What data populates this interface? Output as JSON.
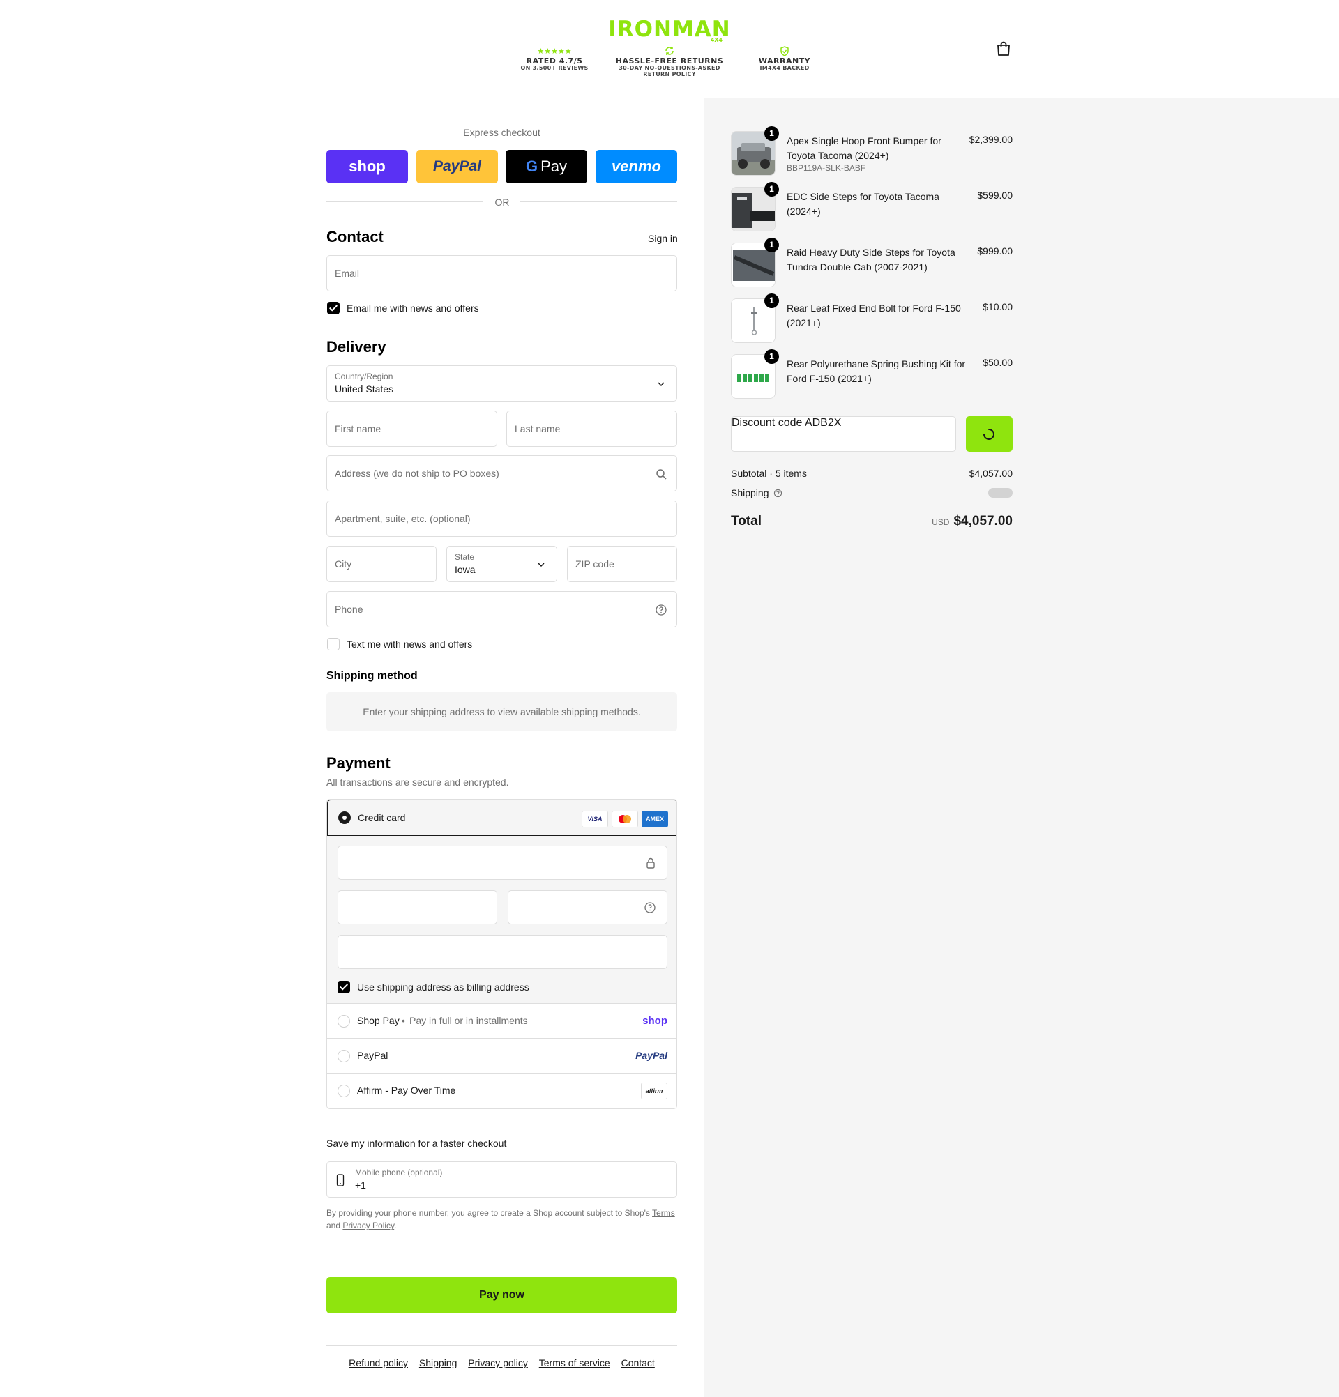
{
  "header": {
    "logo": "IRONMAN",
    "logo_sub": "4X4",
    "badges": [
      {
        "icon": "stars",
        "title": "RATED 4.7/5",
        "sub1": "ON 3,500+ REVIEWS",
        "sub2": ""
      },
      {
        "icon": "refresh-icon",
        "title": "HASSLE-FREE RETURNS",
        "sub1": "30-DAY NO-QUESTIONS-ASKED",
        "sub2": "RETURN POLICY"
      },
      {
        "icon": "shield-check-icon",
        "title": "WARRANTY",
        "sub1": "IM4X4 BACKED",
        "sub2": ""
      }
    ],
    "stars": "★★★★★"
  },
  "express": {
    "title": "Express checkout",
    "shop": "shop",
    "paypal": "PayPal",
    "gpay": "G Pay",
    "venmo": "venmo",
    "or": "OR"
  },
  "contact": {
    "title": "Contact",
    "sign_in": "Sign in",
    "email_placeholder": "Email",
    "email_opt_in": "Email me with news and offers",
    "email_opt_in_checked": true
  },
  "delivery": {
    "title": "Delivery",
    "country_label": "Country/Region",
    "country_value": "United States",
    "first_name_placeholder": "First name",
    "last_name_placeholder": "Last name",
    "address_placeholder": "Address (we do not ship to PO boxes)",
    "apartment_placeholder": "Apartment, suite, etc. (optional)",
    "city_placeholder": "City",
    "state_label": "State",
    "state_value": "Iowa",
    "zip_placeholder": "ZIP code",
    "phone_placeholder": "Phone",
    "text_opt_in": "Text me with news and offers",
    "text_opt_in_checked": false
  },
  "shipping_method": {
    "title": "Shipping method",
    "message": "Enter your shipping address to view available shipping methods."
  },
  "payment": {
    "title": "Payment",
    "subtitle": "All transactions are secure and encrypted.",
    "credit_card_label": "Credit card",
    "card_brands": [
      "VISA",
      "MC",
      "AMEX"
    ],
    "billing_same": "Use shipping address as billing address",
    "billing_same_checked": true,
    "options": [
      {
        "label": "Shop Pay",
        "note": "Pay in full or in installments",
        "logo": "shop"
      },
      {
        "label": "PayPal",
        "note": "",
        "logo": "PayPal"
      },
      {
        "label": "Affirm - Pay Over Time",
        "note": "",
        "logo": "affirm"
      }
    ]
  },
  "save_info": {
    "title": "Save my information for a faster checkout",
    "phone_label": "Mobile phone (optional)",
    "phone_value": "+1",
    "legal_prefix": "By providing your phone number, you agree to create a Shop account subject to Shop's",
    "terms": "Terms",
    "and": "and",
    "privacy": "Privacy Policy",
    "period": "."
  },
  "pay_now": "Pay now",
  "footer": [
    "Refund policy",
    "Shipping",
    "Privacy policy",
    "Terms of service",
    "Contact"
  ],
  "order": {
    "items": [
      {
        "name": "Apex Single Hoop Front Bumper for Toyota Tacoma (2024+)",
        "sku": "BBP119A-SLK-BABF",
        "price": "$2,399.00",
        "qty": "1"
      },
      {
        "name": "EDC Side Steps for Toyota Tacoma (2024+)",
        "sku": "",
        "price": "$599.00",
        "qty": "1"
      },
      {
        "name": "Raid Heavy Duty Side Steps for Toyota Tundra Double Cab (2007-2021)",
        "sku": "",
        "price": "$999.00",
        "qty": "1"
      },
      {
        "name": "Rear Leaf Fixed End Bolt for Ford F-150 (2021+)",
        "sku": "",
        "price": "$10.00",
        "qty": "1"
      },
      {
        "name": "Rear Polyurethane Spring Bushing Kit for Ford F-150 (2021+)",
        "sku": "",
        "price": "$50.00",
        "qty": "1"
      }
    ],
    "discount_label": "Discount code",
    "discount_value": "ADB2X",
    "subtotal_label": "Subtotal · 5 items",
    "subtotal_value": "$4,057.00",
    "shipping_label": "Shipping",
    "total_label": "Total",
    "currency": "USD",
    "total_value": "$4,057.00"
  },
  "colors": {
    "accent": "#8fe40e",
    "shop": "#5a31f4",
    "paypal": "#ffc439",
    "venmo": "#008cff"
  }
}
